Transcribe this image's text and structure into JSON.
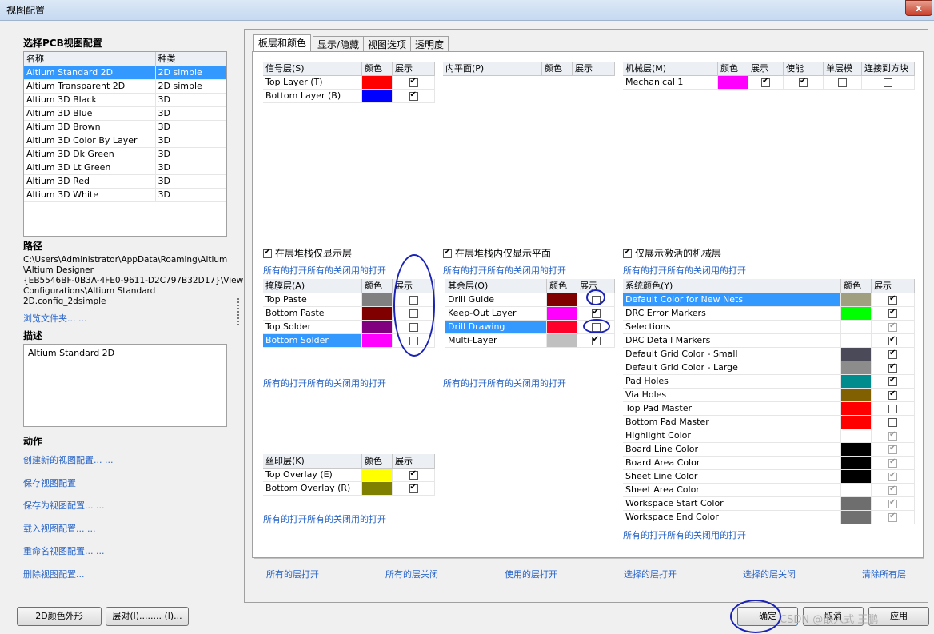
{
  "window": {
    "title": "视图配置",
    "close": "x"
  },
  "left": {
    "heading": "选择PCB视图配置",
    "columns": [
      "名称",
      "种类"
    ],
    "configs": [
      {
        "name": "Altium Standard 2D",
        "kind": "2D simple"
      },
      {
        "name": "Altium Transparent 2D",
        "kind": "2D simple"
      },
      {
        "name": "Altium 3D Black",
        "kind": "3D"
      },
      {
        "name": "Altium 3D Blue",
        "kind": "3D"
      },
      {
        "name": "Altium 3D Brown",
        "kind": "3D"
      },
      {
        "name": "Altium 3D Color By Layer",
        "kind": "3D"
      },
      {
        "name": "Altium 3D Dk Green",
        "kind": "3D"
      },
      {
        "name": "Altium 3D Lt Green",
        "kind": "3D"
      },
      {
        "name": "Altium 3D Red",
        "kind": "3D"
      },
      {
        "name": "Altium 3D White",
        "kind": "3D"
      }
    ],
    "path_heading": "路径",
    "path_lines": [
      "C:\\Users\\Administrator\\AppData\\Roaming\\Altium",
      "\\Altium Designer",
      "{EB5546BF-0B3A-4FE0-9611-D2C797B32D17}\\View",
      "Configurations\\Altium Standard",
      "2D.config_2dsimple"
    ],
    "browse": "浏览文件夹... ...",
    "desc_heading": "描述",
    "desc_text": "Altium Standard 2D",
    "actions_heading": "动作",
    "actions": [
      "创建新的视图配置... ...",
      "保存视图配置",
      "保存为视图配置... ...",
      "载入视图配置... ...",
      "重命名视图配置... ...",
      "删除视图配置..."
    ]
  },
  "tabs": [
    "板层和颜色",
    "显示/隐藏",
    "视图选项",
    "透明度"
  ],
  "signal": {
    "headers": [
      "信号层(S)",
      "颜色",
      "展示"
    ],
    "rows": [
      {
        "name": "Top Layer (T)",
        "color": "#ff0000",
        "show": true
      },
      {
        "name": "Bottom Layer (B)",
        "color": "#0000ff",
        "show": true
      }
    ],
    "stack_only": "在层堆栈仅显示层",
    "links": "所有的打开所有的关闭用的打开"
  },
  "plane": {
    "headers": [
      "内平面(P)",
      "颜色",
      "展示"
    ],
    "stack_only": "在层堆栈内仅显示平面",
    "links": "所有的打开所有的关闭用的打开"
  },
  "mech": {
    "headers": [
      "机械层(M)",
      "颜色",
      "展示",
      "使能",
      "单层模",
      "连接到方块"
    ],
    "rows": [
      {
        "name": "Mechanical 1",
        "color": "#ff00ff",
        "show": true,
        "enable": true,
        "single": false,
        "link": false
      }
    ],
    "active_only": "仅展示激活的机械层",
    "links": "所有的打开所有的关闭用的打开"
  },
  "mask": {
    "headers": [
      "掩膜层(A)",
      "颜色",
      "展示"
    ],
    "rows": [
      {
        "name": "Top Paste",
        "color": "#808080",
        "show": false
      },
      {
        "name": "Bottom Paste",
        "color": "#800000",
        "show": false
      },
      {
        "name": "Top Solder",
        "color": "#800080",
        "show": false
      },
      {
        "name": "Bottom Solder",
        "color": "#ff00ff",
        "show": false
      }
    ],
    "links": "所有的打开所有的关闭用的打开"
  },
  "other": {
    "headers": [
      "其余层(O)",
      "颜色",
      "展示"
    ],
    "rows": [
      {
        "name": "Drill Guide",
        "color": "#800000",
        "show": false
      },
      {
        "name": "Keep-Out Layer",
        "color": "#ff00ff",
        "show": true
      },
      {
        "name": "Drill Drawing",
        "color": "#ff002a",
        "show": false
      },
      {
        "name": "Multi-Layer",
        "color": "#c0c0c0",
        "show": true
      }
    ],
    "links": "所有的打开所有的关闭用的打开"
  },
  "silk": {
    "headers": [
      "丝印层(K)",
      "颜色",
      "展示"
    ],
    "rows": [
      {
        "name": "Top Overlay (E)",
        "color": "#ffff00",
        "show": true
      },
      {
        "name": "Bottom Overlay (R)",
        "color": "#808000",
        "show": true
      }
    ],
    "links": "所有的打开所有的关闭用的打开"
  },
  "system": {
    "headers": [
      "系统颜色(Y)",
      "颜色",
      "展示"
    ],
    "rows": [
      {
        "name": "Default Color for New Nets",
        "color": "#a0a080",
        "show": true,
        "enabled": true
      },
      {
        "name": "DRC Error Markers",
        "color": "#00ff00",
        "show": true,
        "enabled": true
      },
      {
        "name": "Selections",
        "color": "#ffffff",
        "show": true,
        "enabled": false
      },
      {
        "name": "DRC Detail Markers",
        "color": "#ffffff",
        "show": true,
        "enabled": true
      },
      {
        "name": "Default Grid Color - Small",
        "color": "#4a4a58",
        "show": true,
        "enabled": true
      },
      {
        "name": "Default Grid Color - Large",
        "color": "#8c8c8c",
        "show": true,
        "enabled": true
      },
      {
        "name": "Pad Holes",
        "color": "#008c8c",
        "show": true,
        "enabled": true
      },
      {
        "name": "Via Holes",
        "color": "#806000",
        "show": true,
        "enabled": true
      },
      {
        "name": "Top Pad Master",
        "color": "#ff0000",
        "show": false,
        "enabled": true
      },
      {
        "name": "Bottom Pad Master",
        "color": "#ff0000",
        "show": false,
        "enabled": true
      },
      {
        "name": "Highlight Color",
        "color": "#ffffff",
        "show": true,
        "enabled": false
      },
      {
        "name": "Board Line Color",
        "color": "#000000",
        "show": true,
        "enabled": false
      },
      {
        "name": "Board Area Color",
        "color": "#000000",
        "show": true,
        "enabled": false
      },
      {
        "name": "Sheet Line Color",
        "color": "#000000",
        "show": true,
        "enabled": false
      },
      {
        "name": "Sheet Area Color",
        "color": "#ffffff",
        "show": true,
        "enabled": false
      },
      {
        "name": "Workspace Start Color",
        "color": "#6e6e6e",
        "show": true,
        "enabled": false
      },
      {
        "name": "Workspace End Color",
        "color": "#707070",
        "show": true,
        "enabled": false
      }
    ],
    "links": "所有的打开所有的关闭用的打开"
  },
  "bottom_links": [
    "所有的层打开",
    "所有的层关闭",
    "使用的层打开",
    "选择的层打开",
    "选择的层关闭",
    "清除所有层"
  ],
  "buttons": {
    "color2d": "2D颜色外形",
    "layerpair": "层对(l)........ (l)...",
    "ok": "确定",
    "cancel": "取消",
    "apply": "应用"
  },
  "watermark": "CSDN @嵌入式 王鹏"
}
